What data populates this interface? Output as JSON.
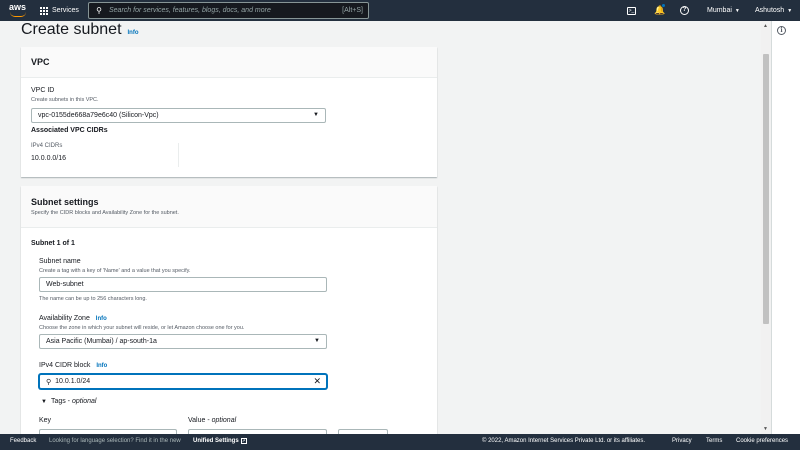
{
  "topnav": {
    "logo_text": "aws",
    "services_label": "Services",
    "search_placeholder": "Search for services, features, blogs, docs, and more",
    "search_shortcut": "[Alt+S]",
    "region": "Mumbai",
    "user": "Ashutosh"
  },
  "page": {
    "title": "Create subnet",
    "title_info": "Info"
  },
  "vpc_card": {
    "title": "VPC",
    "vpc_id_label": "VPC ID",
    "vpc_id_desc": "Create subnets in this VPC.",
    "vpc_id_value": "vpc-0155de668a79e6c40 (Silicon-Vpc)",
    "cidrs_title": "Associated VPC CIDRs",
    "ipv4_label": "IPv4 CIDRs",
    "ipv4_value": "10.0.0.0/16"
  },
  "subnet_card": {
    "title": "Subnet settings",
    "desc": "Specify the CIDR blocks and Availability Zone for the subnet.",
    "subnet_count": "Subnet 1 of 1",
    "name_label": "Subnet name",
    "name_desc": "Create a tag with a key of 'Name' and a value that you specify.",
    "name_value": "Web-subnet",
    "name_hint": "The name can be up to 256 characters long.",
    "az_label": "Availability Zone",
    "az_info": "Info",
    "az_desc": "Choose the zone in which your subnet will reside, or let Amazon choose one for you.",
    "az_value": "Asia Pacific (Mumbai) / ap-south-1a",
    "cidr_label": "IPv4 CIDR block",
    "cidr_info": "Info",
    "cidr_value": "10.0.1.0/24",
    "tags_label": "Tags -",
    "tags_optional": "optional",
    "key_label": "Key",
    "value_label": "Value -",
    "value_optional": "optional"
  },
  "footer": {
    "feedback": "Feedback",
    "lang_text": "Looking for language selection? Find it in the new",
    "unified": "Unified Settings",
    "copyright": "© 2022, Amazon Internet Services Private Ltd. or its affiliates.",
    "privacy": "Privacy",
    "terms": "Terms",
    "cookie": "Cookie preferences"
  }
}
